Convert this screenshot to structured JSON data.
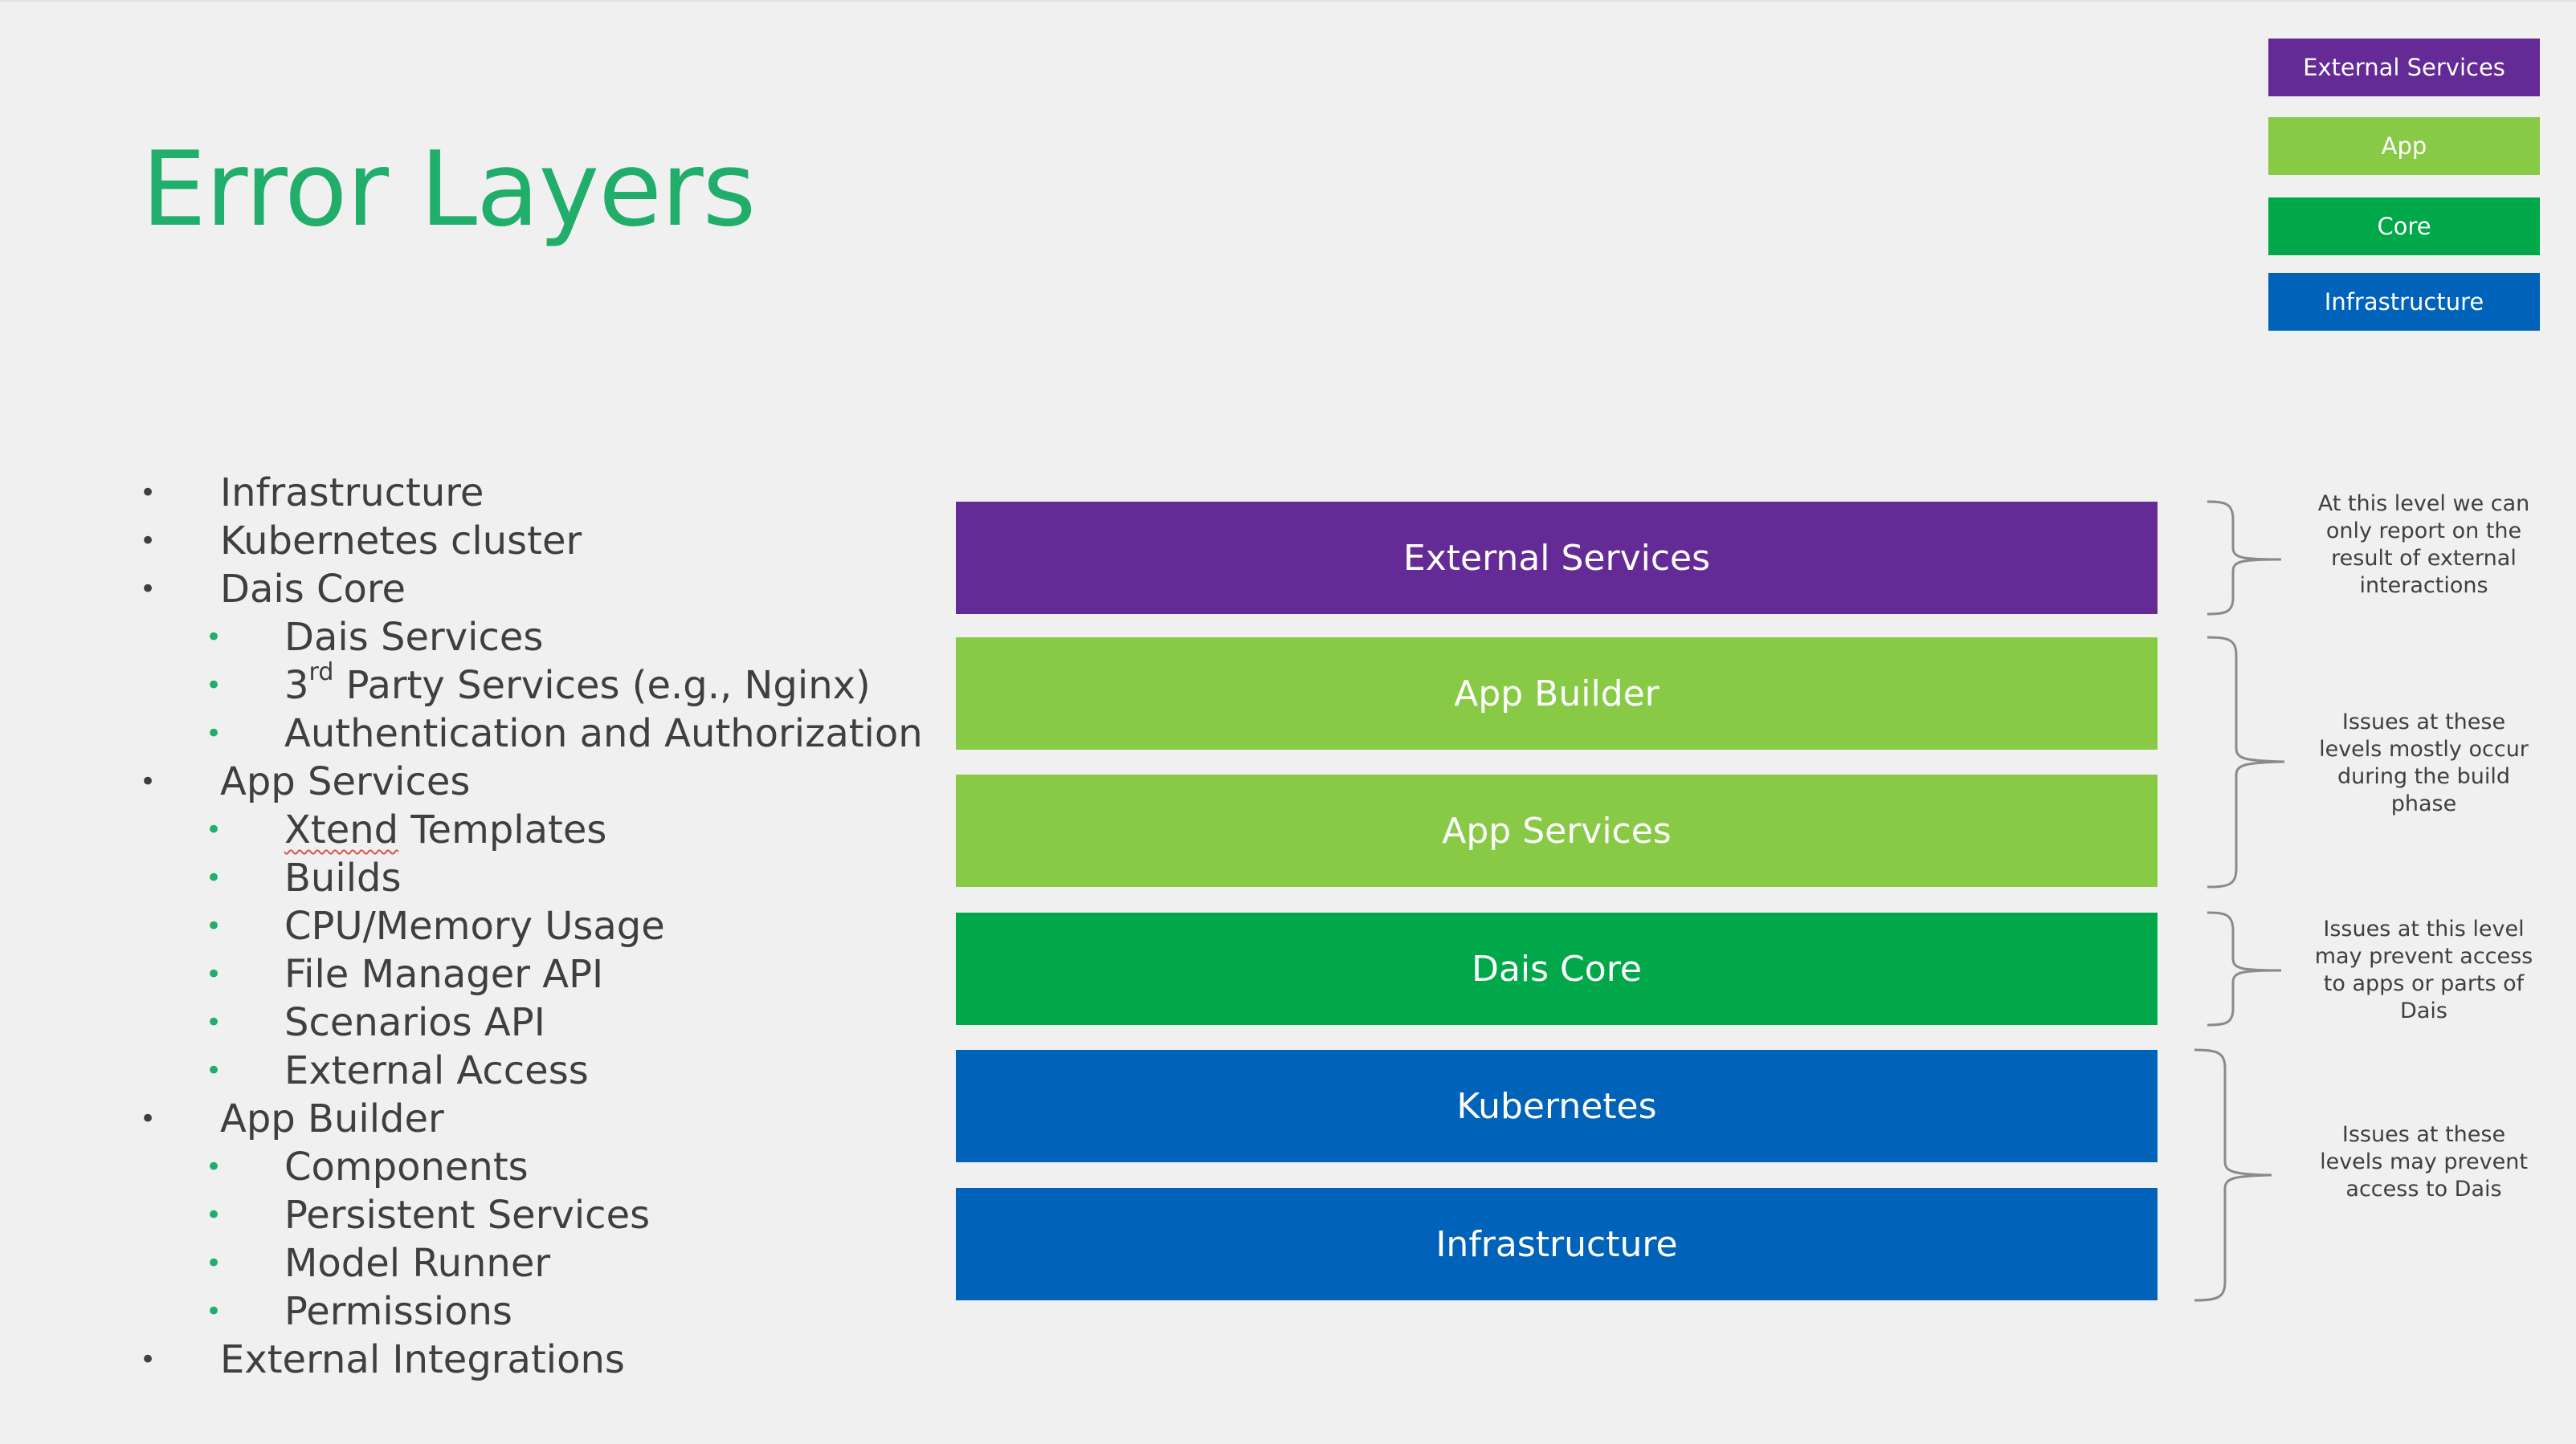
{
  "slide": {
    "title": "Error Layers"
  },
  "legend": [
    {
      "label": "External Services",
      "color": "#642a96"
    },
    {
      "label": "App",
      "color": "#88c946"
    },
    {
      "label": "Core",
      "color": "#00a84a"
    },
    {
      "label": "Infrastructure",
      "color": "#0063b9"
    }
  ],
  "bullets": [
    {
      "level": 1,
      "text": "Infrastructure"
    },
    {
      "level": 1,
      "text": "Kubernetes cluster"
    },
    {
      "level": 1,
      "text": "Dais Core"
    },
    {
      "level": 2,
      "text": "Dais Services"
    },
    {
      "level": 2,
      "text_prefix": "3",
      "text_sup": "rd",
      "text_rest": " Party Services (e.g., Nginx)"
    },
    {
      "level": 2,
      "text": "Authentication and Authorization"
    },
    {
      "level": 1,
      "text": "App Services"
    },
    {
      "level": 2,
      "text_word": "Xtend",
      "text_rest": " Templates"
    },
    {
      "level": 2,
      "text": "Builds"
    },
    {
      "level": 2,
      "text": "CPU/Memory Usage"
    },
    {
      "level": 2,
      "text": "File Manager API"
    },
    {
      "level": 2,
      "text": "Scenarios API"
    },
    {
      "level": 2,
      "text": "External Access"
    },
    {
      "level": 1,
      "text": "App Builder"
    },
    {
      "level": 2,
      "text": "Components"
    },
    {
      "level": 2,
      "text": "Persistent Services"
    },
    {
      "level": 2,
      "text": "Model Runner"
    },
    {
      "level": 2,
      "text": "Permissions"
    },
    {
      "level": 1,
      "text": "External Integrations"
    }
  ],
  "bullet_glyph": "•",
  "layers": [
    {
      "label": "External Services",
      "color": "#642a96"
    },
    {
      "label": "App Builder",
      "color": "#88c946"
    },
    {
      "label": "App Services",
      "color": "#88c946"
    },
    {
      "label": "Dais Core",
      "color": "#00a84a"
    },
    {
      "label": "Kubernetes",
      "color": "#0063b9"
    },
    {
      "label": "Infrastructure",
      "color": "#0063b9"
    }
  ],
  "notes": [
    {
      "text": "At this level we can only report on the result of external interactions"
    },
    {
      "text": "Issues at these levels mostly occur during the build phase"
    },
    {
      "text": "Issues at this level may prevent access to apps or parts of Dais"
    },
    {
      "text": "Issues at these levels may prevent access to Dais"
    }
  ],
  "colors": {
    "title": "#21ad6a",
    "text": "#3f3f3f",
    "sub_bullet": "#21ad6a",
    "brace": "#8a8a8a",
    "background": "#f0f0f0"
  }
}
